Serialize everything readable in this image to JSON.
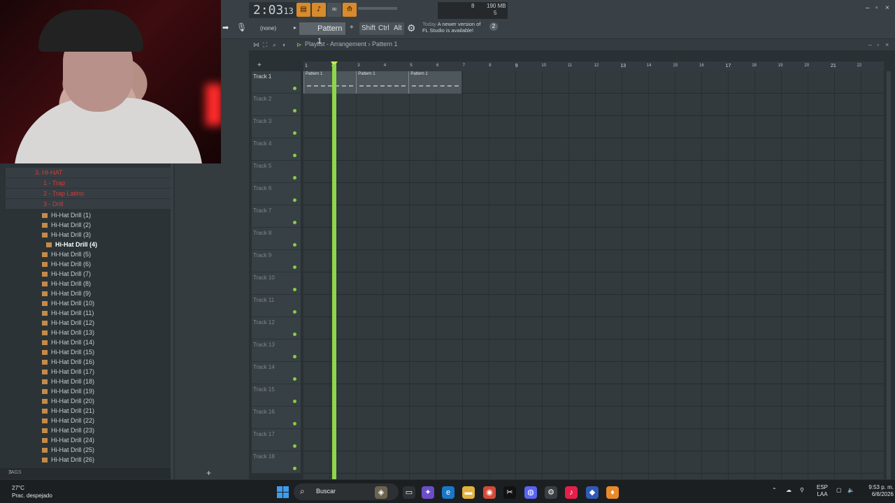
{
  "toolbar": {
    "time_main": "2:03",
    "time_frac": "13",
    "memory": "190 MB",
    "cpu_num": "8",
    "voices": "5",
    "pattern_selector": "(none)",
    "pattern": "Pattern 1",
    "keys": [
      "Shift",
      "Ctrl",
      "Alt"
    ],
    "news_day": "Today",
    "news_text_1": "A newer version of",
    "news_text_2": "FL Studio is available!",
    "news_count": "2"
  },
  "playlist": {
    "breadcrumb": "Playlist - Arrangement › Pattern 1",
    "bars": [
      "1",
      "2",
      "3",
      "4",
      "5",
      "6",
      "7",
      "8",
      "9",
      "10",
      "11",
      "12",
      "13",
      "14",
      "15",
      "16",
      "17",
      "18",
      "19",
      "20",
      "21",
      "22"
    ],
    "tracks": [
      "Track 1",
      "Track 2",
      "Track 3",
      "Track 4",
      "Track 5",
      "Track 6",
      "Track 7",
      "Track 8",
      "Track 9",
      "Track 10",
      "Track 11",
      "Track 12",
      "Track 13",
      "Track 14",
      "Track 15",
      "Track 16",
      "Track 17",
      "Track 18"
    ],
    "clips": [
      "Pattern 1",
      "Pattern 1",
      "Pattern 1"
    ],
    "clip_start_bars": [
      1,
      3,
      5
    ],
    "clip_length_bars": 2,
    "playhead_bar": 2.1
  },
  "browser": {
    "folders": [
      "3. HI-HAT",
      "1 - Trap",
      "2 - Trap Latino",
      "3 - Drill"
    ],
    "files": [
      "Hi-Hat Drill (1)",
      "Hi-Hat Drill (2)",
      "Hi-Hat Drill (3)",
      "Hi-Hat Drill (4)",
      "Hi-Hat Drill (5)",
      "Hi-Hat Drill (6)",
      "Hi-Hat Drill (7)",
      "Hi-Hat Drill (8)",
      "Hi-Hat Drill (9)",
      "Hi-Hat Drill (10)",
      "Hi-Hat Drill (11)",
      "Hi-Hat Drill (12)",
      "Hi-Hat Drill (13)",
      "Hi-Hat Drill (14)",
      "Hi-Hat Drill (15)",
      "Hi-Hat Drill (16)",
      "Hi-Hat Drill (17)",
      "Hi-Hat Drill (18)",
      "Hi-Hat Drill (19)",
      "Hi-Hat Drill (20)",
      "Hi-Hat Drill (21)",
      "Hi-Hat Drill (22)",
      "Hi-Hat Drill (23)",
      "Hi-Hat Drill (24)",
      "Hi-Hat Drill (25)",
      "Hi-Hat Drill (26)"
    ],
    "selected_index": 3,
    "tags_label": "TAGS"
  },
  "taskbar": {
    "temperature": "27°C",
    "weather": "Prac. despejado",
    "search_placeholder": "Buscar",
    "lang_1": "ESP",
    "lang_2": "LAA",
    "time": "9:53 p. m.",
    "date": "6/8/2026"
  },
  "colors": {
    "accent": "#d98a2b",
    "playhead": "#8ed64a",
    "folder": "#d43a3a"
  }
}
